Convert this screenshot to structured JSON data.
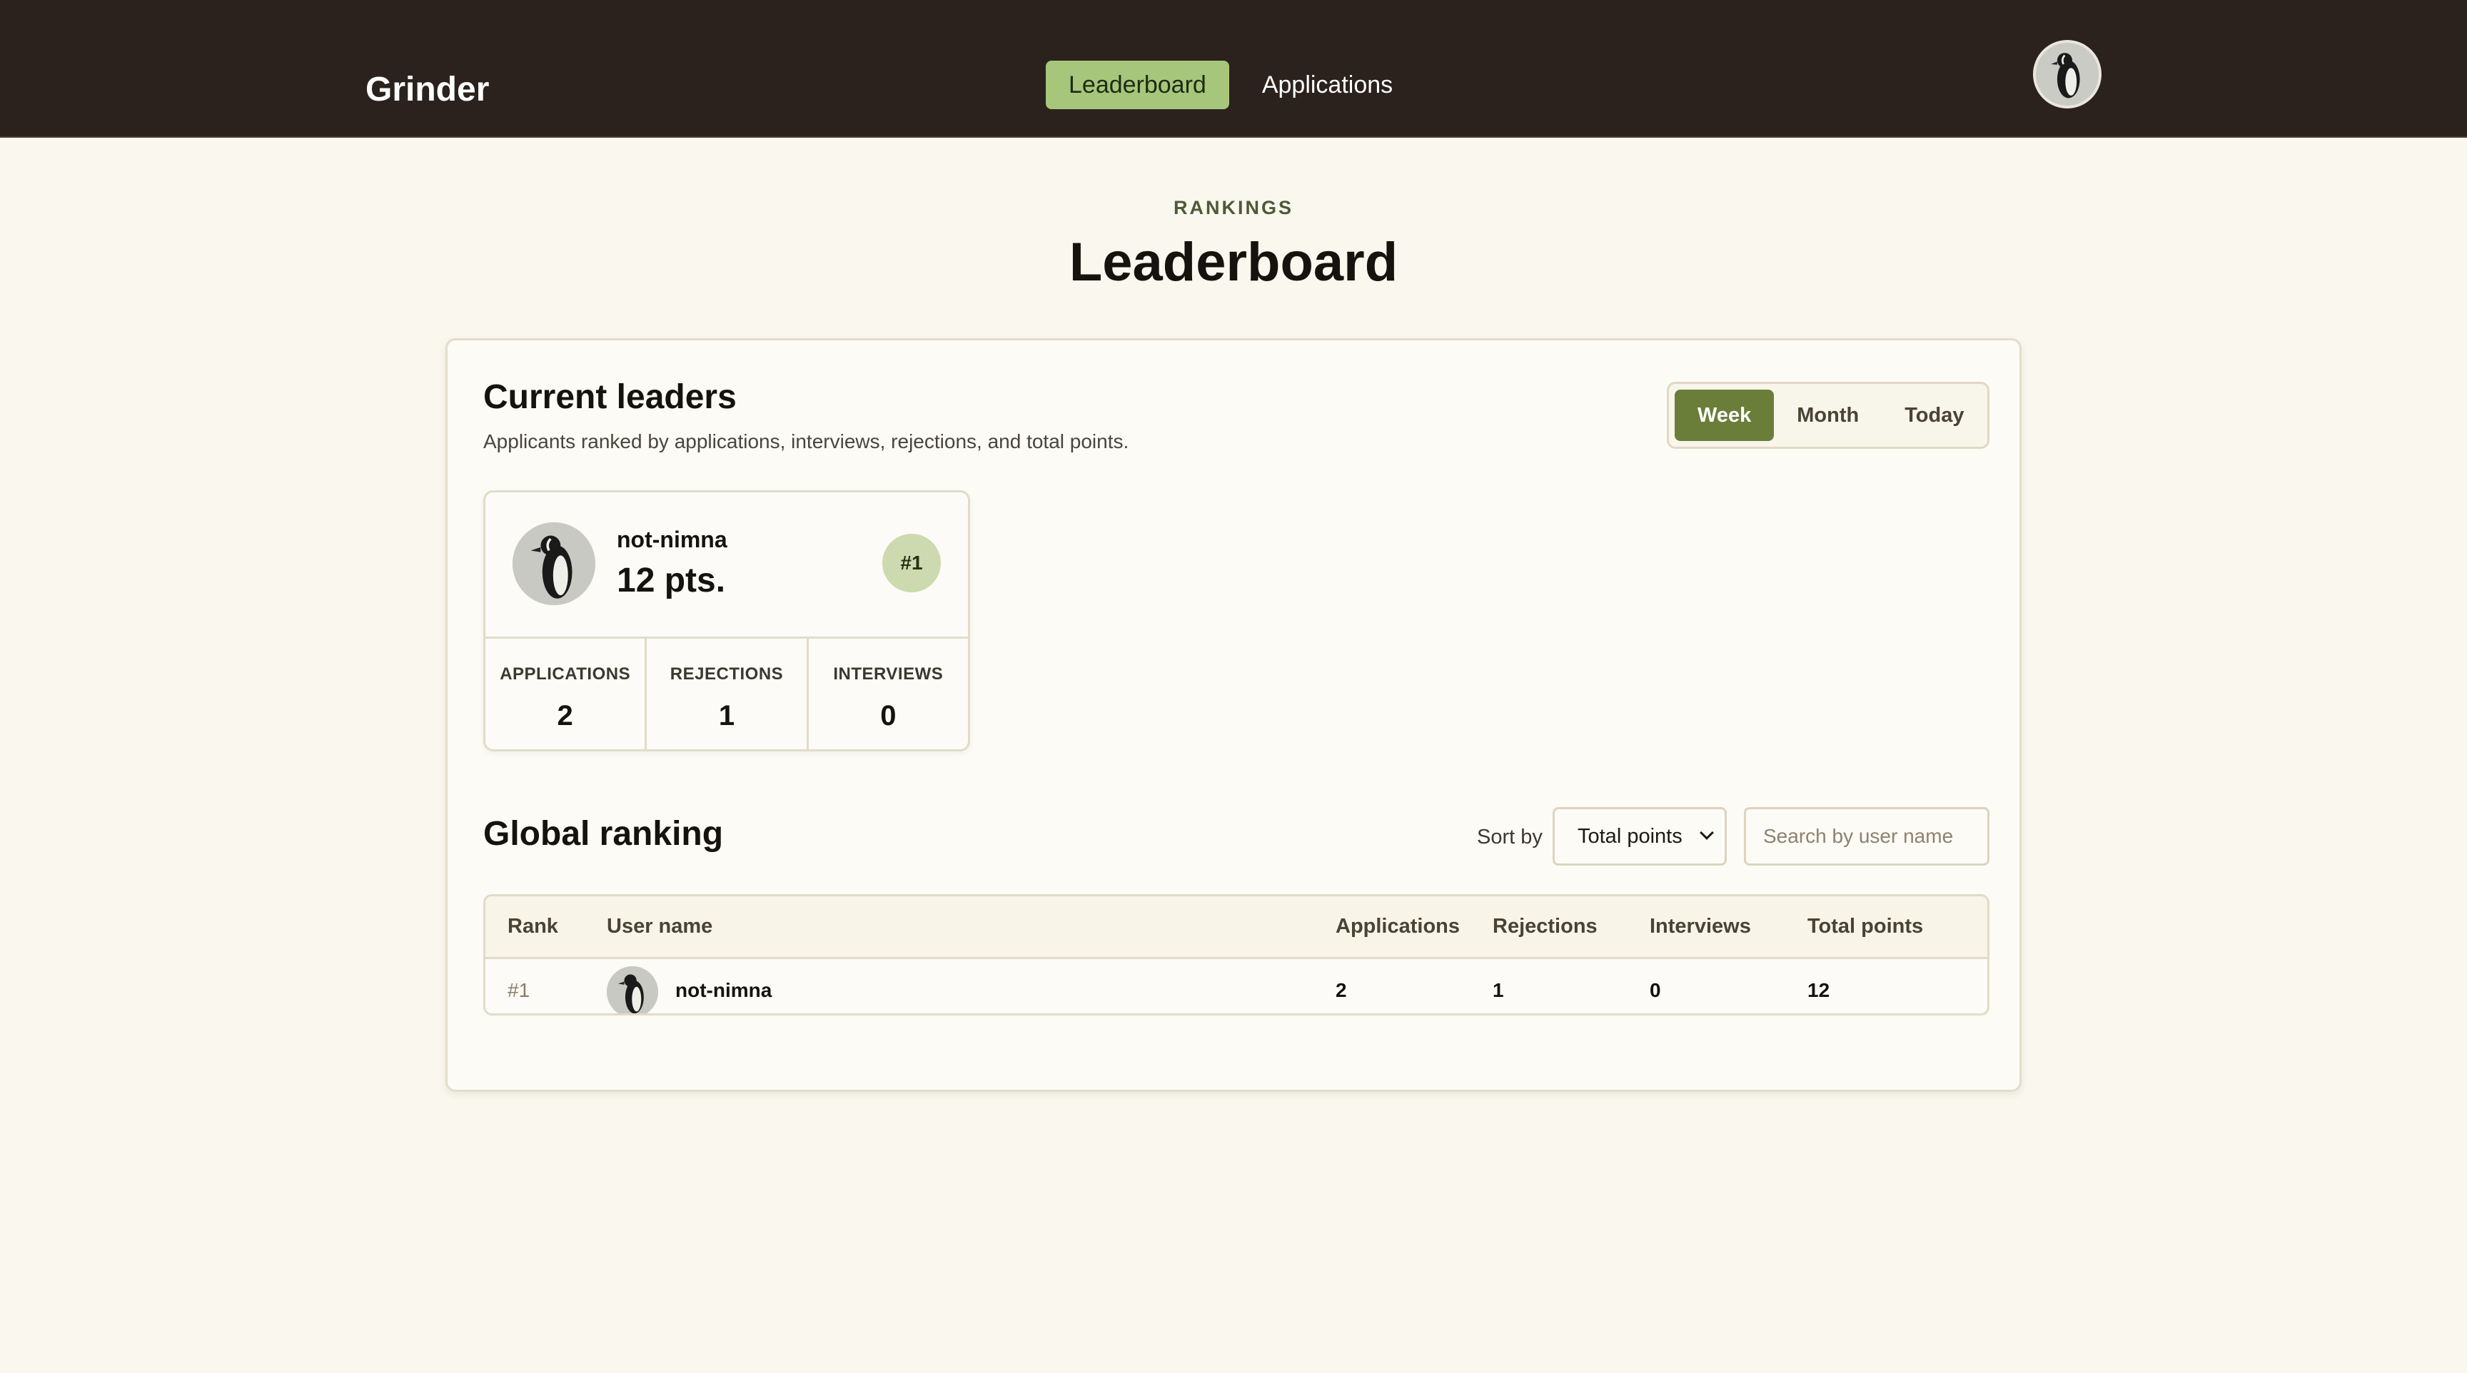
{
  "nav": {
    "brand": "Grinder",
    "links": [
      {
        "label": "Leaderboard",
        "active": true
      },
      {
        "label": "Applications",
        "active": false
      }
    ],
    "avatar_icon": "penguin-avatar"
  },
  "header": {
    "eyebrow": "RANKINGS",
    "title": "Leaderboard"
  },
  "current_leaders": {
    "title": "Current leaders",
    "subtitle": "Applicants ranked by applications, interviews, rejections, and total points.",
    "periods": [
      {
        "label": "Week",
        "active": true
      },
      {
        "label": "Month",
        "active": false
      },
      {
        "label": "Today",
        "active": false
      }
    ],
    "leader": {
      "name": "not-nimna",
      "points": "12 pts.",
      "rank": "#1",
      "stats": [
        {
          "label": "APPLICATIONS",
          "value": "2"
        },
        {
          "label": "REJECTIONS",
          "value": "1"
        },
        {
          "label": "INTERVIEWS",
          "value": "0"
        }
      ]
    }
  },
  "global_ranking": {
    "title": "Global ranking",
    "sort_label": "Sort by",
    "sort_value": "Total points",
    "search_placeholder": "Search by user name",
    "columns": [
      "Rank",
      "User name",
      "Applications",
      "Rejections",
      "Interviews",
      "Total points"
    ],
    "rows": [
      {
        "rank": "#1",
        "user": "not-nimna",
        "applications": "2",
        "rejections": "1",
        "interviews": "0",
        "total": "12"
      }
    ]
  },
  "colors": {
    "nav_bg": "#2b211d",
    "nav_active": "#a6c77b",
    "page_bg": "#f9f7ee",
    "period_active": "#6a7e3a",
    "rank_badge": "#cdd9ae"
  }
}
